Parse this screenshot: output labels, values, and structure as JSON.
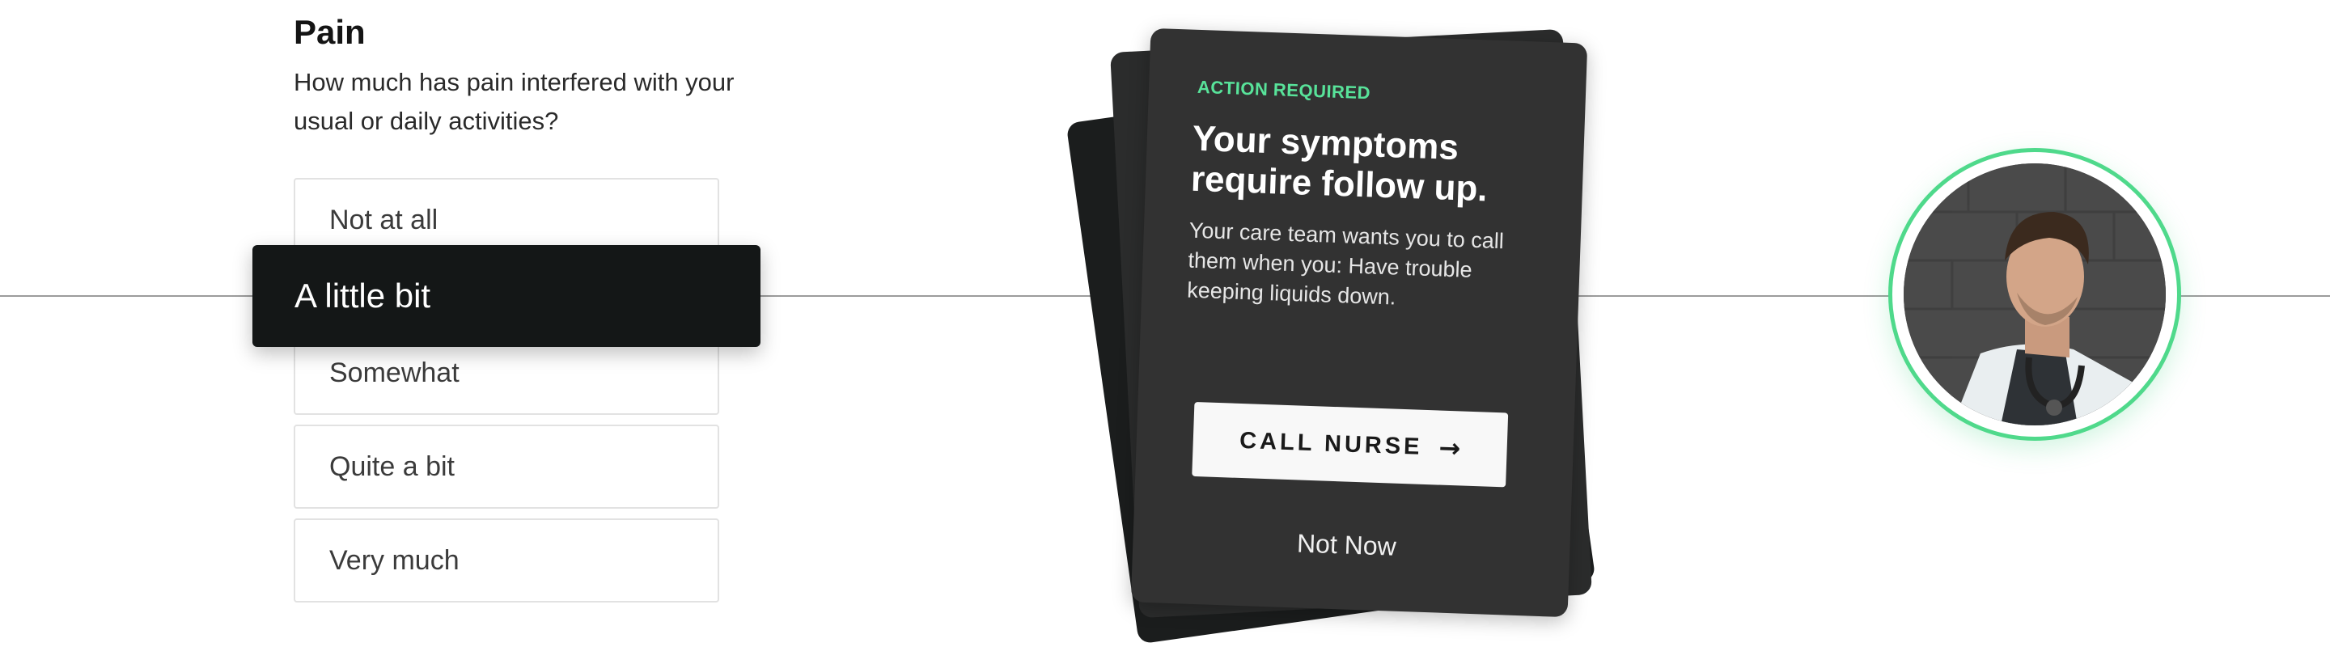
{
  "question": {
    "title": "Pain",
    "prompt": "How much has pain interfered with your usual or daily activities?",
    "options": [
      {
        "label": "Not at all",
        "selected": false
      },
      {
        "label": "A little bit",
        "selected": true
      },
      {
        "label": "Somewhat",
        "selected": false
      },
      {
        "label": "Quite a bit",
        "selected": false
      },
      {
        "label": "Very much",
        "selected": false
      }
    ]
  },
  "card": {
    "eyebrow": "ACTION REQUIRED",
    "heading": "Your symptoms require follow up.",
    "body": "Your care team wants you to call them when you: Have trouble keeping liquids down.",
    "primary_button": {
      "label": "CALL NURSE",
      "icon": "arrow-right-icon",
      "glyph": "→"
    },
    "secondary_button": {
      "label": "Not Now"
    }
  },
  "avatar": {
    "description_icon": "clinician-avatar",
    "ring_color": "#4fd98b"
  },
  "colors": {
    "accent": "#58e39a",
    "card_bg": "#323232",
    "selected_option_bg": "#141717"
  }
}
